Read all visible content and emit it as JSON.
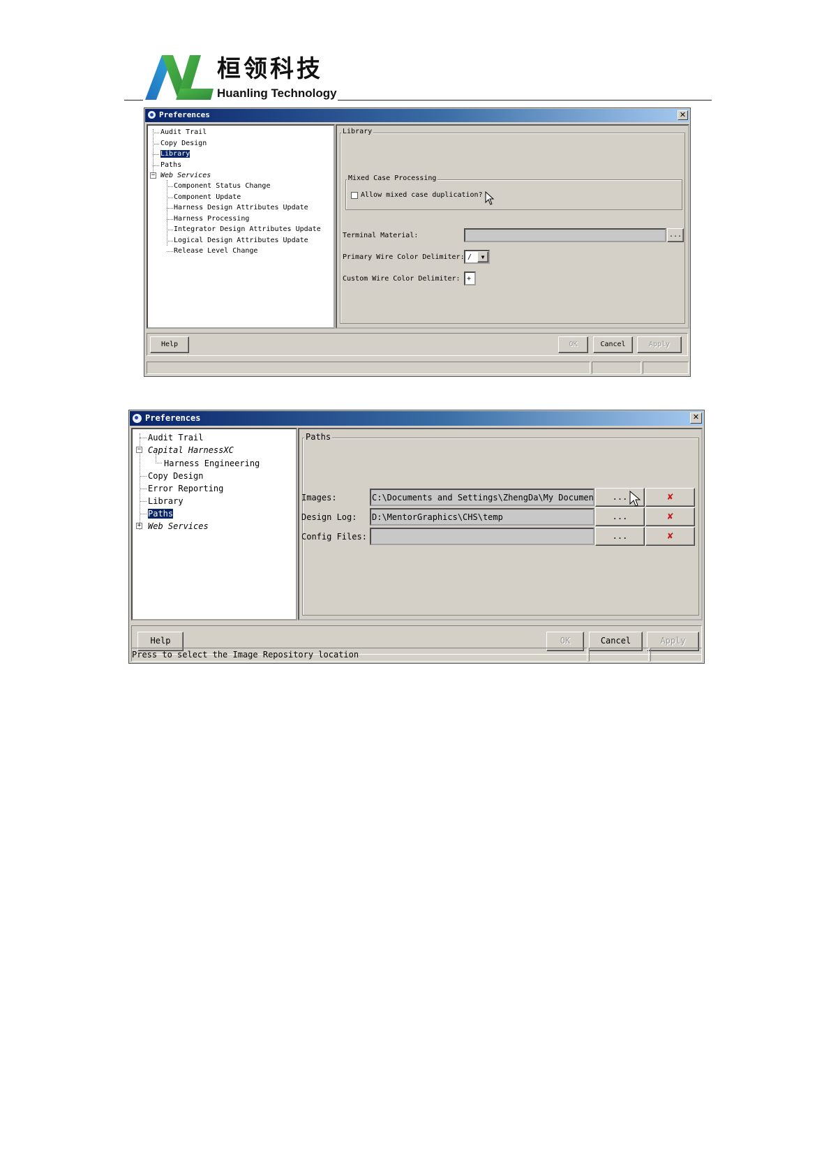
{
  "header": {
    "company_cn": "桓领科技",
    "company_en": "Huanling Technology"
  },
  "dialog1": {
    "title": "Preferences",
    "tree": [
      {
        "label": "Audit Trail"
      },
      {
        "label": "Copy Design"
      },
      {
        "label": "Library",
        "selected": true
      },
      {
        "label": "Paths"
      },
      {
        "label": "Web Services",
        "italic": true,
        "expanded": true
      },
      {
        "label": "Component Status Change"
      },
      {
        "label": "Component Update"
      },
      {
        "label": "Harness Design Attributes Update"
      },
      {
        "label": "Harness Processing"
      },
      {
        "label": "Integrator Design Attributes Update"
      },
      {
        "label": "Logical Design Attributes Update"
      },
      {
        "label": "Release Level Change"
      }
    ],
    "panel_title": "Library",
    "mixed_case_group": "Mixed Case Processing",
    "allow_mixed_case_label": "Allow mixed case duplication?",
    "allow_mixed_case_checked": false,
    "terminal_material_label": "Terminal Material:",
    "terminal_material_value": "",
    "browse_label": "...",
    "primary_delim_label": "Primary Wire Color Delimiter:",
    "primary_delim_value": "/",
    "custom_delim_label": "Custom Wire Color Delimiter:",
    "custom_delim_value": "+",
    "buttons": {
      "help": "Help",
      "ok": "OK",
      "cancel": "Cancel",
      "apply": "Apply"
    },
    "status_text": ""
  },
  "dialog2": {
    "title": "Preferences",
    "tree": [
      {
        "label": "Audit Trail"
      },
      {
        "label": "Capital HarnessXC",
        "italic": true,
        "expanded": true
      },
      {
        "label": "Harness Engineering"
      },
      {
        "label": "Copy Design"
      },
      {
        "label": "Error Reporting"
      },
      {
        "label": "Library"
      },
      {
        "label": "Paths",
        "selected": true
      },
      {
        "label": "Web Services",
        "italic": true,
        "expanded": false
      }
    ],
    "panel_title": "Paths",
    "paths": [
      {
        "label": "Images:",
        "value": "C:\\Documents and Settings\\ZhengDa\\My Documents"
      },
      {
        "label": "Design Log:",
        "value": "D:\\MentorGraphics\\CHS\\temp"
      },
      {
        "label": "Config Files:",
        "value": ""
      }
    ],
    "browse_label": "...",
    "clear_icon": "red-x-icon",
    "buttons": {
      "help": "Help",
      "ok": "OK",
      "cancel": "Cancel",
      "apply": "Apply"
    },
    "status_text": "Press to select the Image Repository location"
  }
}
